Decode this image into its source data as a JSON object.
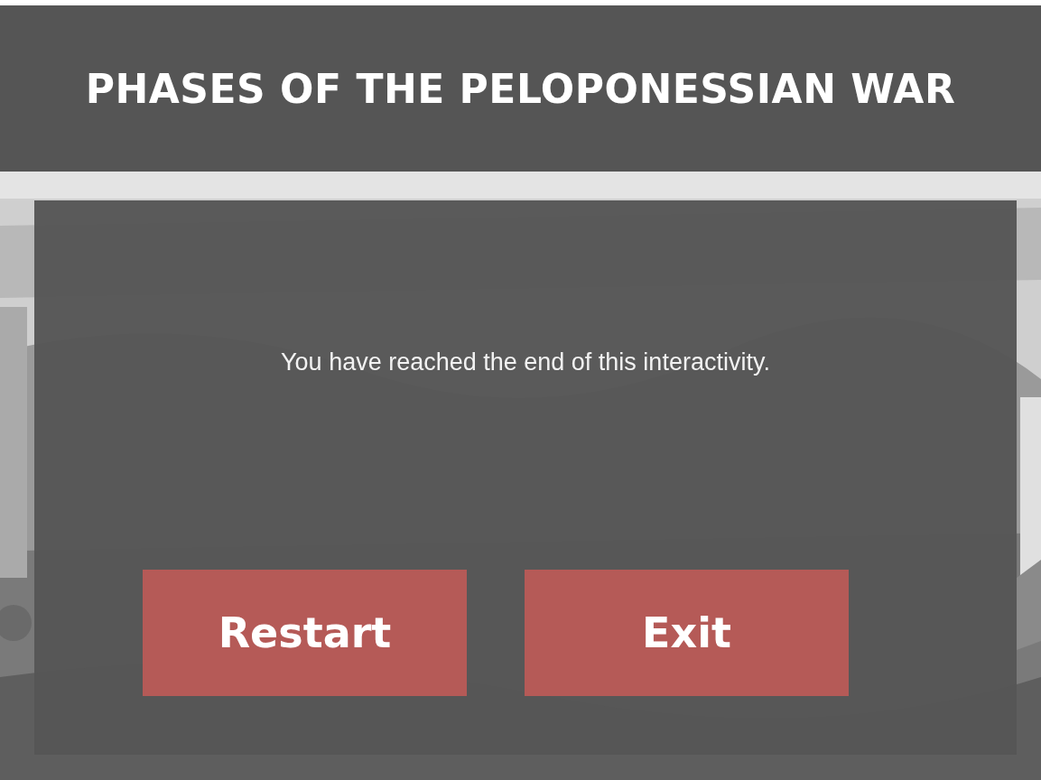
{
  "header": {
    "title": "PHASES OF THE PELOPONESSIAN WAR"
  },
  "dialog": {
    "message": "You have reached the end of this interactivity.",
    "buttons": [
      {
        "label": "Restart"
      },
      {
        "label": "Exit"
      }
    ]
  }
}
